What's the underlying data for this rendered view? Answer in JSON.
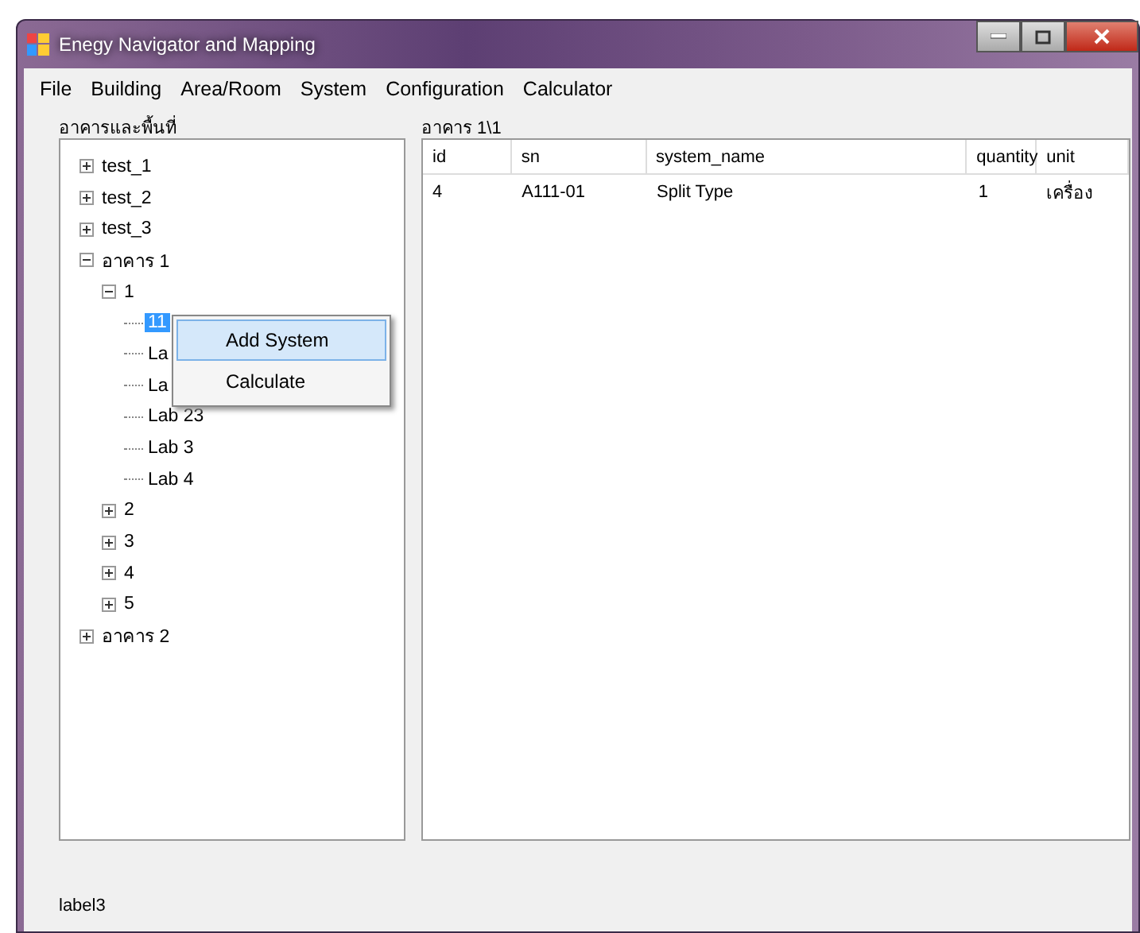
{
  "window": {
    "title": "Enegy Navigator and Mapping"
  },
  "menu": [
    "File",
    "Building",
    "Area/Room",
    "System",
    "Configuration",
    "Calculator"
  ],
  "tree_panel": {
    "label": "อาคารและพื้นที่",
    "nodes": [
      {
        "label": "test_1",
        "expanded": false,
        "selected": false
      },
      {
        "label": "test_2",
        "expanded": false,
        "selected": false
      },
      {
        "label": "test_3",
        "expanded": false,
        "selected": false
      },
      {
        "label": "อาคาร 1",
        "expanded": true,
        "selected": false,
        "children": [
          {
            "label": "1",
            "expanded": true,
            "selected": false,
            "children": [
              {
                "label": "11",
                "selected": true
              },
              {
                "label": "La",
                "selected": false
              },
              {
                "label": "La",
                "selected": false
              },
              {
                "label": "Lab 23",
                "selected": false
              },
              {
                "label": "Lab 3",
                "selected": false
              },
              {
                "label": "Lab 4",
                "selected": false
              }
            ]
          },
          {
            "label": "2",
            "expanded": false,
            "selected": false
          },
          {
            "label": "3",
            "expanded": false,
            "selected": false
          },
          {
            "label": "4",
            "expanded": false,
            "selected": false
          },
          {
            "label": "5",
            "expanded": false,
            "selected": false
          }
        ]
      },
      {
        "label": "อาคาร 2",
        "expanded": false,
        "selected": false
      }
    ]
  },
  "context_menu": [
    {
      "label": "Add System",
      "selected": true
    },
    {
      "label": "Calculate",
      "selected": false
    }
  ],
  "grid_panel": {
    "label": "อาคาร 1\\1",
    "columns": [
      "id",
      "sn",
      "system_name",
      "quantity",
      "unit"
    ],
    "rows": [
      [
        "4",
        "A111-01",
        "Split Type",
        "1",
        "เครื่อง"
      ]
    ]
  },
  "status_label": "label3"
}
